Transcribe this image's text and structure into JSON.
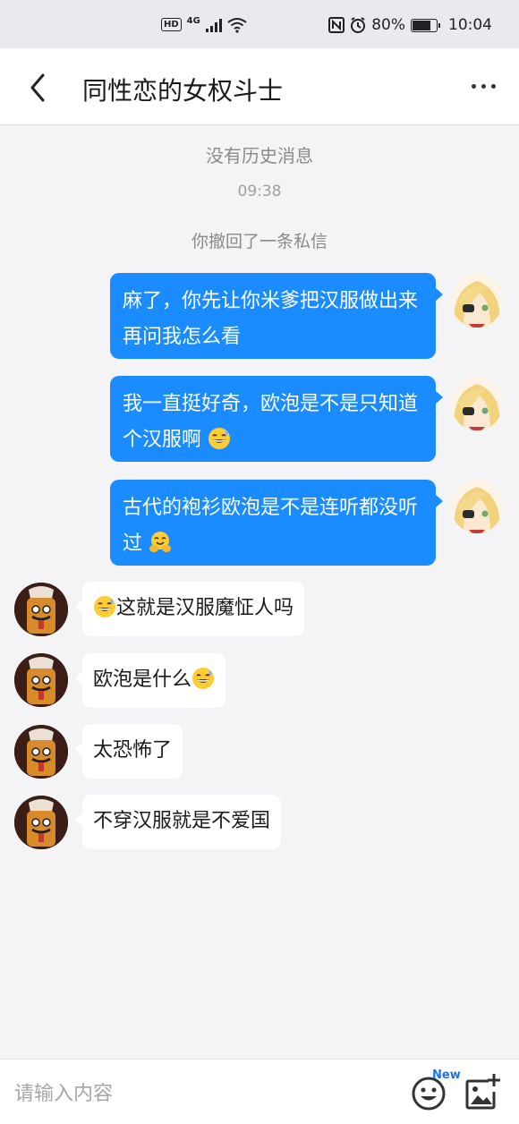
{
  "status_bar": {
    "left_badges": "HD",
    "network": "4G",
    "battery_percent": "80%",
    "battery_level": 0.8,
    "time": "10:04",
    "icons": [
      "hd-icon",
      "signal-icon",
      "wifi-icon",
      "nfc-icon",
      "alarm-icon",
      "battery-icon"
    ]
  },
  "header": {
    "back_icon": "chevron-left-icon",
    "title": "同性恋的女权斗士",
    "more_icon": "more-dots-icon"
  },
  "chat": {
    "no_history": "没有历史消息",
    "timestamp": "09:38",
    "recalled": "你撤回了一条私信",
    "outgoing": [
      {
        "text": "麻了，你先让你米爹把汉服做出来再问我怎么看",
        "emoji": ""
      },
      {
        "text": "我一直挺好奇，欧泡是不是只知道个汉服啊",
        "emoji": "grinning-sweat-emoji"
      },
      {
        "text": "古代的袍衫欧泡是不是连听都没听过",
        "emoji": "hugging-emoji"
      }
    ],
    "incoming": [
      {
        "prefix_emoji": "grinning-sweat-emoji",
        "text": "这就是汉服魔怔人吗"
      },
      {
        "text": "欧泡是什么",
        "suffix_emoji": "grinning-sweat-emoji"
      },
      {
        "text": "太恐怖了"
      },
      {
        "text": "不穿汉服就是不爱国"
      }
    ]
  },
  "input_bar": {
    "placeholder": "请输入内容",
    "emoji_button_icon": "smiley-icon",
    "new_badge": "New",
    "image_button_icon": "add-image-icon"
  },
  "colors": {
    "accent": "#1a8cff",
    "background": "#f4f4f6",
    "bubble_incoming": "#ffffff"
  }
}
